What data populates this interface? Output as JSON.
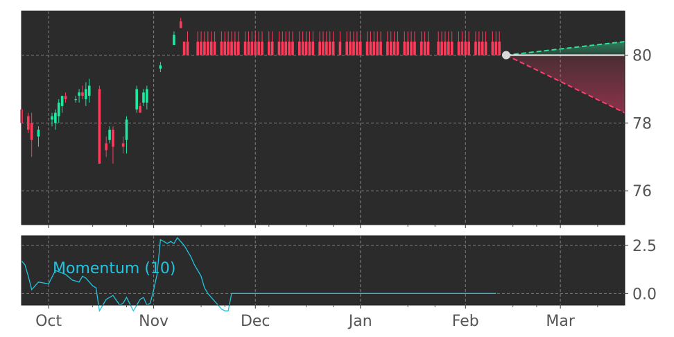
{
  "colors": {
    "panel_bg": "#2b2b2b",
    "grid": "#808080",
    "up": "#1de9a0",
    "down": "#ff3b5c",
    "momentum": "#22c4e0",
    "forecast_up": "#2ee59a",
    "forecast_down": "#ff3d6e",
    "axis_text": "#555555"
  },
  "chart_data": [
    {
      "type": "candlestick",
      "name": "price",
      "ylim": [
        75,
        81.3
      ],
      "yticks": [
        76,
        78,
        80
      ],
      "ytick_labels": [
        "76",
        "78",
        "80"
      ],
      "grid": true,
      "candles": [
        {
          "d": 0,
          "o": 78.4,
          "h": 78.5,
          "l": 77.8,
          "c": 78.0
        },
        {
          "d": 2,
          "o": 78.2,
          "h": 78.3,
          "l": 77.7,
          "c": 77.8
        },
        {
          "d": 3,
          "o": 78.0,
          "h": 78.3,
          "l": 77.0,
          "c": 77.5
        },
        {
          "d": 5,
          "o": 77.6,
          "h": 77.9,
          "l": 77.3,
          "c": 77.8
        },
        {
          "d": 9,
          "o": 78.1,
          "h": 78.3,
          "l": 77.9,
          "c": 78.2
        },
        {
          "d": 10,
          "o": 78.0,
          "h": 78.4,
          "l": 77.8,
          "c": 78.3
        },
        {
          "d": 11,
          "o": 78.2,
          "h": 78.7,
          "l": 78.0,
          "c": 78.6
        },
        {
          "d": 12,
          "o": 78.5,
          "h": 78.7,
          "l": 78.3,
          "c": 78.8
        },
        {
          "d": 13,
          "o": 78.8,
          "h": 78.9,
          "l": 78.6,
          "c": 78.7
        },
        {
          "d": 16,
          "o": 78.7,
          "h": 78.8,
          "l": 78.6,
          "c": 78.7
        },
        {
          "d": 17,
          "o": 78.8,
          "h": 79.0,
          "l": 78.6,
          "c": 78.9
        },
        {
          "d": 18,
          "o": 78.9,
          "h": 79.1,
          "l": 78.7,
          "c": 78.8
        },
        {
          "d": 19,
          "o": 78.7,
          "h": 79.2,
          "l": 78.5,
          "c": 79.0
        },
        {
          "d": 20,
          "o": 78.8,
          "h": 79.3,
          "l": 78.6,
          "c": 79.1
        },
        {
          "d": 23,
          "o": 79.0,
          "h": 79.1,
          "l": 76.8,
          "c": 76.8
        },
        {
          "d": 25,
          "o": 77.4,
          "h": 77.6,
          "l": 77.0,
          "c": 77.2
        },
        {
          "d": 26,
          "o": 77.5,
          "h": 77.9,
          "l": 77.4,
          "c": 77.8
        },
        {
          "d": 27,
          "o": 77.8,
          "h": 77.9,
          "l": 76.8,
          "c": 77.3
        },
        {
          "d": 30,
          "o": 77.4,
          "h": 77.6,
          "l": 77.1,
          "c": 77.3
        },
        {
          "d": 31,
          "o": 77.5,
          "h": 78.2,
          "l": 77.1,
          "c": 78.1
        },
        {
          "d": 34,
          "o": 78.4,
          "h": 79.1,
          "l": 78.3,
          "c": 79.0
        },
        {
          "d": 35,
          "o": 78.5,
          "h": 78.6,
          "l": 78.3,
          "c": 78.3
        },
        {
          "d": 36,
          "o": 78.6,
          "h": 79.0,
          "l": 78.5,
          "c": 78.9
        },
        {
          "d": 37,
          "o": 78.6,
          "h": 79.1,
          "l": 78.4,
          "c": 79.0
        },
        {
          "d": 41,
          "o": 79.6,
          "h": 79.8,
          "l": 79.5,
          "c": 79.7
        },
        {
          "d": 45,
          "o": 80.3,
          "h": 80.7,
          "l": 80.3,
          "c": 80.6
        },
        {
          "d": 47,
          "o": 81.0,
          "h": 81.1,
          "l": 80.8,
          "c": 80.8
        },
        {
          "d": 48,
          "o": 80.4,
          "h": 80.4,
          "l": 80.0,
          "c": 80.0
        }
      ],
      "flat_candles": {
        "open": 80.4,
        "high": 80.7,
        "low": 80.0,
        "close": 80.0,
        "segments": [
          [
            49,
            49
          ],
          [
            52,
            57
          ],
          [
            59,
            64
          ],
          [
            66,
            71
          ],
          [
            73,
            74
          ],
          [
            76,
            80
          ],
          [
            82,
            86
          ],
          [
            88,
            92
          ],
          [
            94,
            94
          ],
          [
            96,
            100
          ],
          [
            102,
            106
          ],
          [
            108,
            111
          ],
          [
            113,
            116
          ],
          [
            118,
            120
          ],
          [
            123,
            127
          ],
          [
            129,
            132
          ],
          [
            134,
            137
          ],
          [
            139,
            141
          ]
        ]
      },
      "forecast": {
        "start": {
          "d": 143,
          "v": 80.0
        },
        "end_d": 178,
        "upper": 80.4,
        "mid": 80.0,
        "lower": 78.3
      }
    },
    {
      "type": "line",
      "name": "momentum",
      "label": "Momentum (10)",
      "ylim": [
        -0.6,
        3.0
      ],
      "yticks": [
        0.0,
        2.5
      ],
      "ytick_labels": [
        "0.0",
        "2.5"
      ],
      "grid": true,
      "x": [
        0,
        1,
        2,
        3,
        5,
        8,
        10,
        13,
        15,
        17,
        18,
        19,
        20,
        21,
        22,
        23,
        24,
        25,
        27,
        29,
        30,
        31,
        33,
        34,
        35,
        36,
        37,
        38,
        39,
        40,
        41,
        42,
        43,
        44,
        45,
        46,
        48,
        50,
        51,
        52,
        53,
        54,
        55,
        57,
        58,
        59,
        60,
        61,
        62,
        63,
        140
      ],
      "y": [
        1.7,
        1.5,
        0.9,
        0.2,
        0.6,
        0.5,
        1.2,
        1.0,
        0.7,
        0.6,
        0.9,
        0.8,
        0.6,
        0.4,
        0.3,
        -0.9,
        -0.6,
        -0.3,
        -0.1,
        -0.6,
        -0.5,
        -0.2,
        -0.9,
        -0.6,
        -0.3,
        -0.2,
        -0.6,
        -0.5,
        0.2,
        1.0,
        2.8,
        2.7,
        2.6,
        2.7,
        2.6,
        2.9,
        2.5,
        1.9,
        1.5,
        1.2,
        0.9,
        0.3,
        0.0,
        -0.4,
        -0.6,
        -0.8,
        -0.9,
        -0.9,
        0.0,
        0.0,
        0.0
      ]
    }
  ],
  "x_axis": {
    "ticks": [
      {
        "label": "Oct",
        "d": 8
      },
      {
        "label": "Nov",
        "d": 39
      },
      {
        "label": "Dec",
        "d": 69
      },
      {
        "label": "Jan",
        "d": 100
      },
      {
        "label": "Feb",
        "d": 131
      },
      {
        "label": "Mar",
        "d": 159
      }
    ],
    "minor_ticks": [
      21,
      31,
      53,
      60,
      73,
      84,
      92,
      114,
      122,
      145,
      152,
      170
    ],
    "xlim": [
      0,
      178
    ]
  }
}
